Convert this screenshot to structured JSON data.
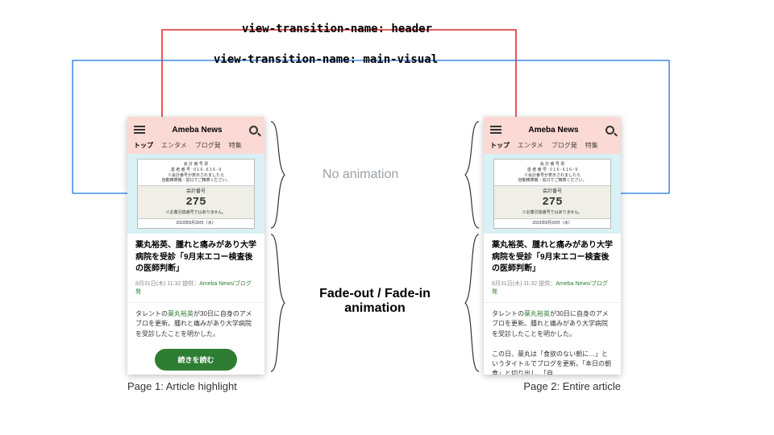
{
  "code_labels": {
    "header": "view-transition-name: header",
    "main_visual": "view-transition-name: main-visual"
  },
  "annotations": {
    "no_animation": "No animation",
    "fade": "Fade-out / Fade-in\nanimation"
  },
  "captions": {
    "left": "Page 1: Article highlight",
    "right": "Page 2: Entire article"
  },
  "mockup": {
    "brand": "Ameba News",
    "tabs": [
      "トップ",
      "エンタメ",
      "ブログ発",
      "特集"
    ],
    "ticket": {
      "label_a": "会 計 番 号 票",
      "small1": "患 者 番 号 : 0 1 6 - 6 1 6 - 9",
      "small2": "※会計番号が表示されましたら\n自動精算機・窓口でご精算ください。",
      "band_label": "会計番号",
      "number": "275",
      "foot": "※お薬引換番号ではありません。",
      "date": "2023年8月30日（水）"
    },
    "article": {
      "title": "薬丸裕英、腫れと痛みがあり大学病院を受診「9月末エコー検査後の医師判断」",
      "meta_time": "8月31日(木) 11:32",
      "meta_provider": "提供：",
      "meta_source": "Ameba News/ブログ発",
      "body1": "タレントの薬丸裕英が30日に自身のアメブロを更新。腫れと痛みがあり大学病院を受診したことを明かした。",
      "body_link": "薬丸裕英",
      "body2_a": "この日、薬丸は「食欲のない朝に…」というタイトルでブログを更新。「本日の朝食」と切り出し",
      "cta": "続きを読む"
    }
  }
}
